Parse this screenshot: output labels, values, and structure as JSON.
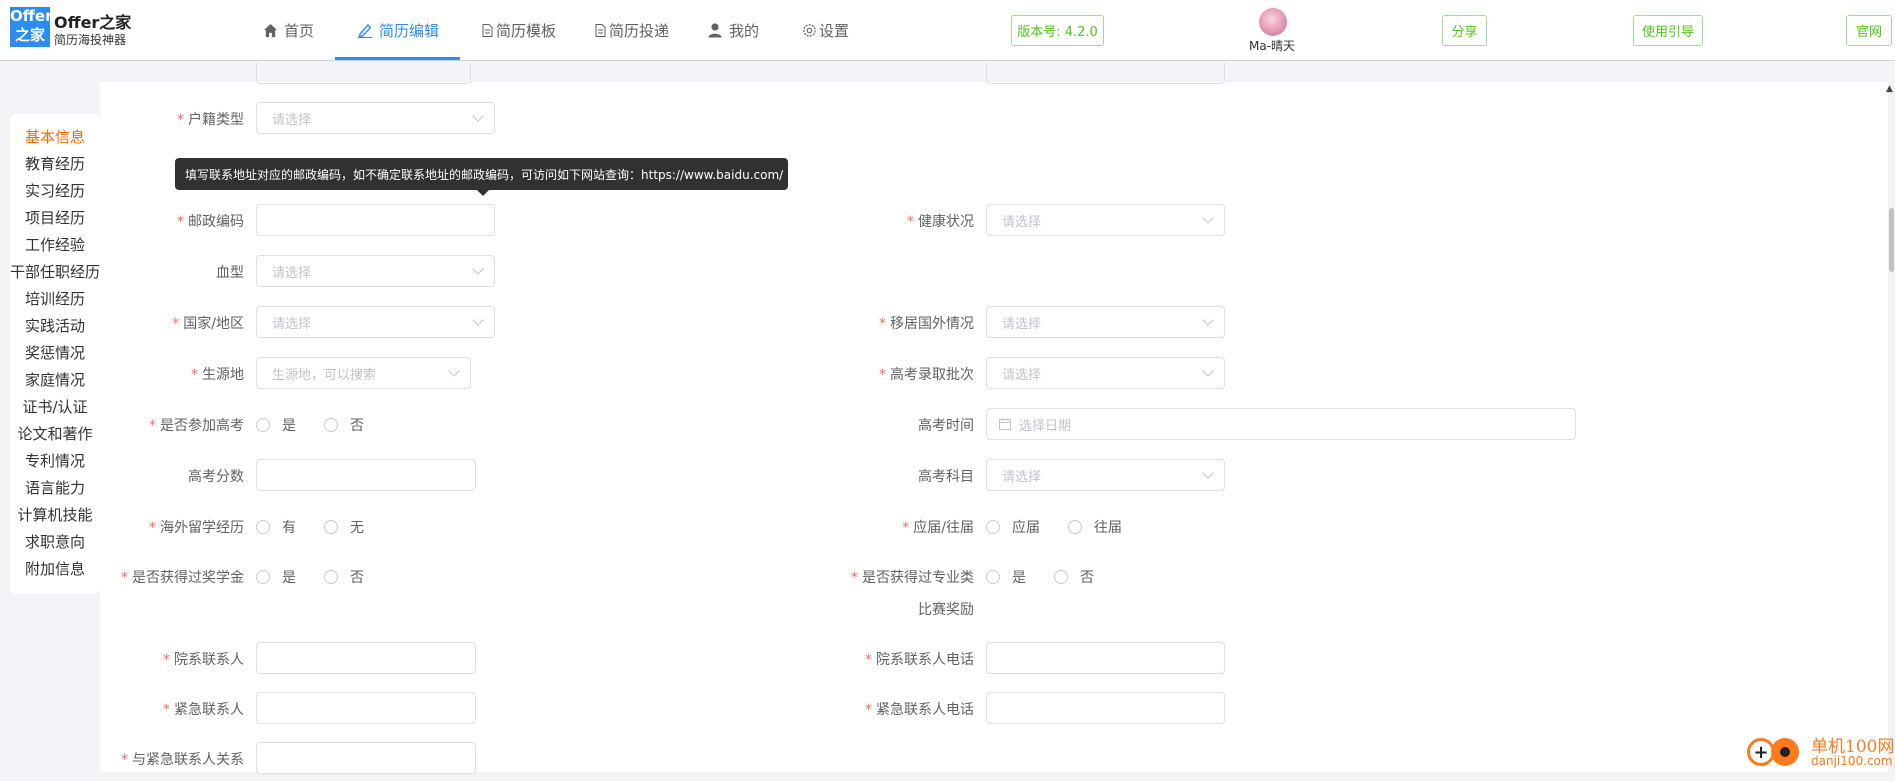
{
  "app": {
    "logo_line1": "Offer",
    "logo_line2": "之家",
    "title": "Offer之家",
    "subtitle": "简历海投神器"
  },
  "nav": [
    {
      "label": "首页",
      "icon": "home-icon"
    },
    {
      "label": "简历编辑",
      "icon": "edit-icon",
      "active": true
    },
    {
      "label": "简历模板",
      "icon": "document-icon"
    },
    {
      "label": "简历投递",
      "icon": "document-icon"
    },
    {
      "label": "我的",
      "icon": "user-icon"
    },
    {
      "label": "设置",
      "icon": "gear-icon"
    }
  ],
  "header_buttons": {
    "version": "版本号: 4.2.0",
    "share": "分享",
    "guide": "使用引导",
    "official": "官网"
  },
  "user": {
    "name": "Ma-晴天"
  },
  "sidebar": [
    {
      "label": "基本信息",
      "active": true
    },
    {
      "label": "教育经历"
    },
    {
      "label": "实习经历"
    },
    {
      "label": "项目经历"
    },
    {
      "label": "工作经验"
    },
    {
      "label": "干部任职经历"
    },
    {
      "label": "培训经历"
    },
    {
      "label": "实践活动"
    },
    {
      "label": "奖惩情况"
    },
    {
      "label": "家庭情况"
    },
    {
      "label": "证书/认证"
    },
    {
      "label": "论文和著作"
    },
    {
      "label": "专利情况"
    },
    {
      "label": "语言能力"
    },
    {
      "label": "计算机技能"
    },
    {
      "label": "求职意向"
    },
    {
      "label": "附加信息"
    }
  ],
  "tooltip": "填写联系地址对应的邮政编码，如不确定联系地址的邮政编码，可访问如下网站查询：https://www.baidu.com/",
  "form": {
    "hukou_type": {
      "label": "户籍类型",
      "placeholder": "请选择"
    },
    "postal_code": {
      "label": "邮政编码",
      "value": ""
    },
    "health": {
      "label": "健康状况",
      "placeholder": "请选择"
    },
    "blood_type": {
      "label": "血型",
      "placeholder": "请选择"
    },
    "country": {
      "label": "国家/地区",
      "placeholder": "请选择"
    },
    "abroad": {
      "label": "移居国外情况",
      "placeholder": "请选择"
    },
    "origin": {
      "label": "生源地",
      "placeholder": "生源地，可以搜索"
    },
    "gaokao_batch": {
      "label": "高考录取批次",
      "placeholder": "请选择"
    },
    "gaokao_joined": {
      "label": "是否参加高考",
      "options": [
        "是",
        "否"
      ]
    },
    "gaokao_time": {
      "label": "高考时间",
      "placeholder": "选择日期"
    },
    "gaokao_score": {
      "label": "高考分数",
      "value": ""
    },
    "gaokao_subject": {
      "label": "高考科目",
      "placeholder": "请选择"
    },
    "study_abroad": {
      "label": "海外留学经历",
      "options": [
        "有",
        "无"
      ]
    },
    "graduate_status": {
      "label": "应届/往届",
      "options": [
        "应届",
        "往届"
      ]
    },
    "scholarship": {
      "label": "是否获得过奖学金",
      "options": [
        "是",
        "否"
      ]
    },
    "competition_award": {
      "label_line1": "是否获得过专业类",
      "label_line2": "比赛奖励",
      "options": [
        "是",
        "否"
      ]
    },
    "dept_contact": {
      "label": "院系联系人",
      "value": ""
    },
    "dept_contact_phone": {
      "label": "院系联系人电话",
      "value": ""
    },
    "emergency_contact": {
      "label": "紧急联系人",
      "value": ""
    },
    "emergency_contact_phone": {
      "label": "紧急联系人电话",
      "value": ""
    },
    "emergency_relation": {
      "label": "与紧急联系人关系",
      "value": ""
    }
  },
  "watermark": {
    "cn": "单机100网",
    "url": "danji100.com"
  },
  "colors": {
    "primary": "#2d8cf0",
    "active_side": "#ff6a00",
    "required": "#f56c6c",
    "green_btn": "#52c41a"
  }
}
